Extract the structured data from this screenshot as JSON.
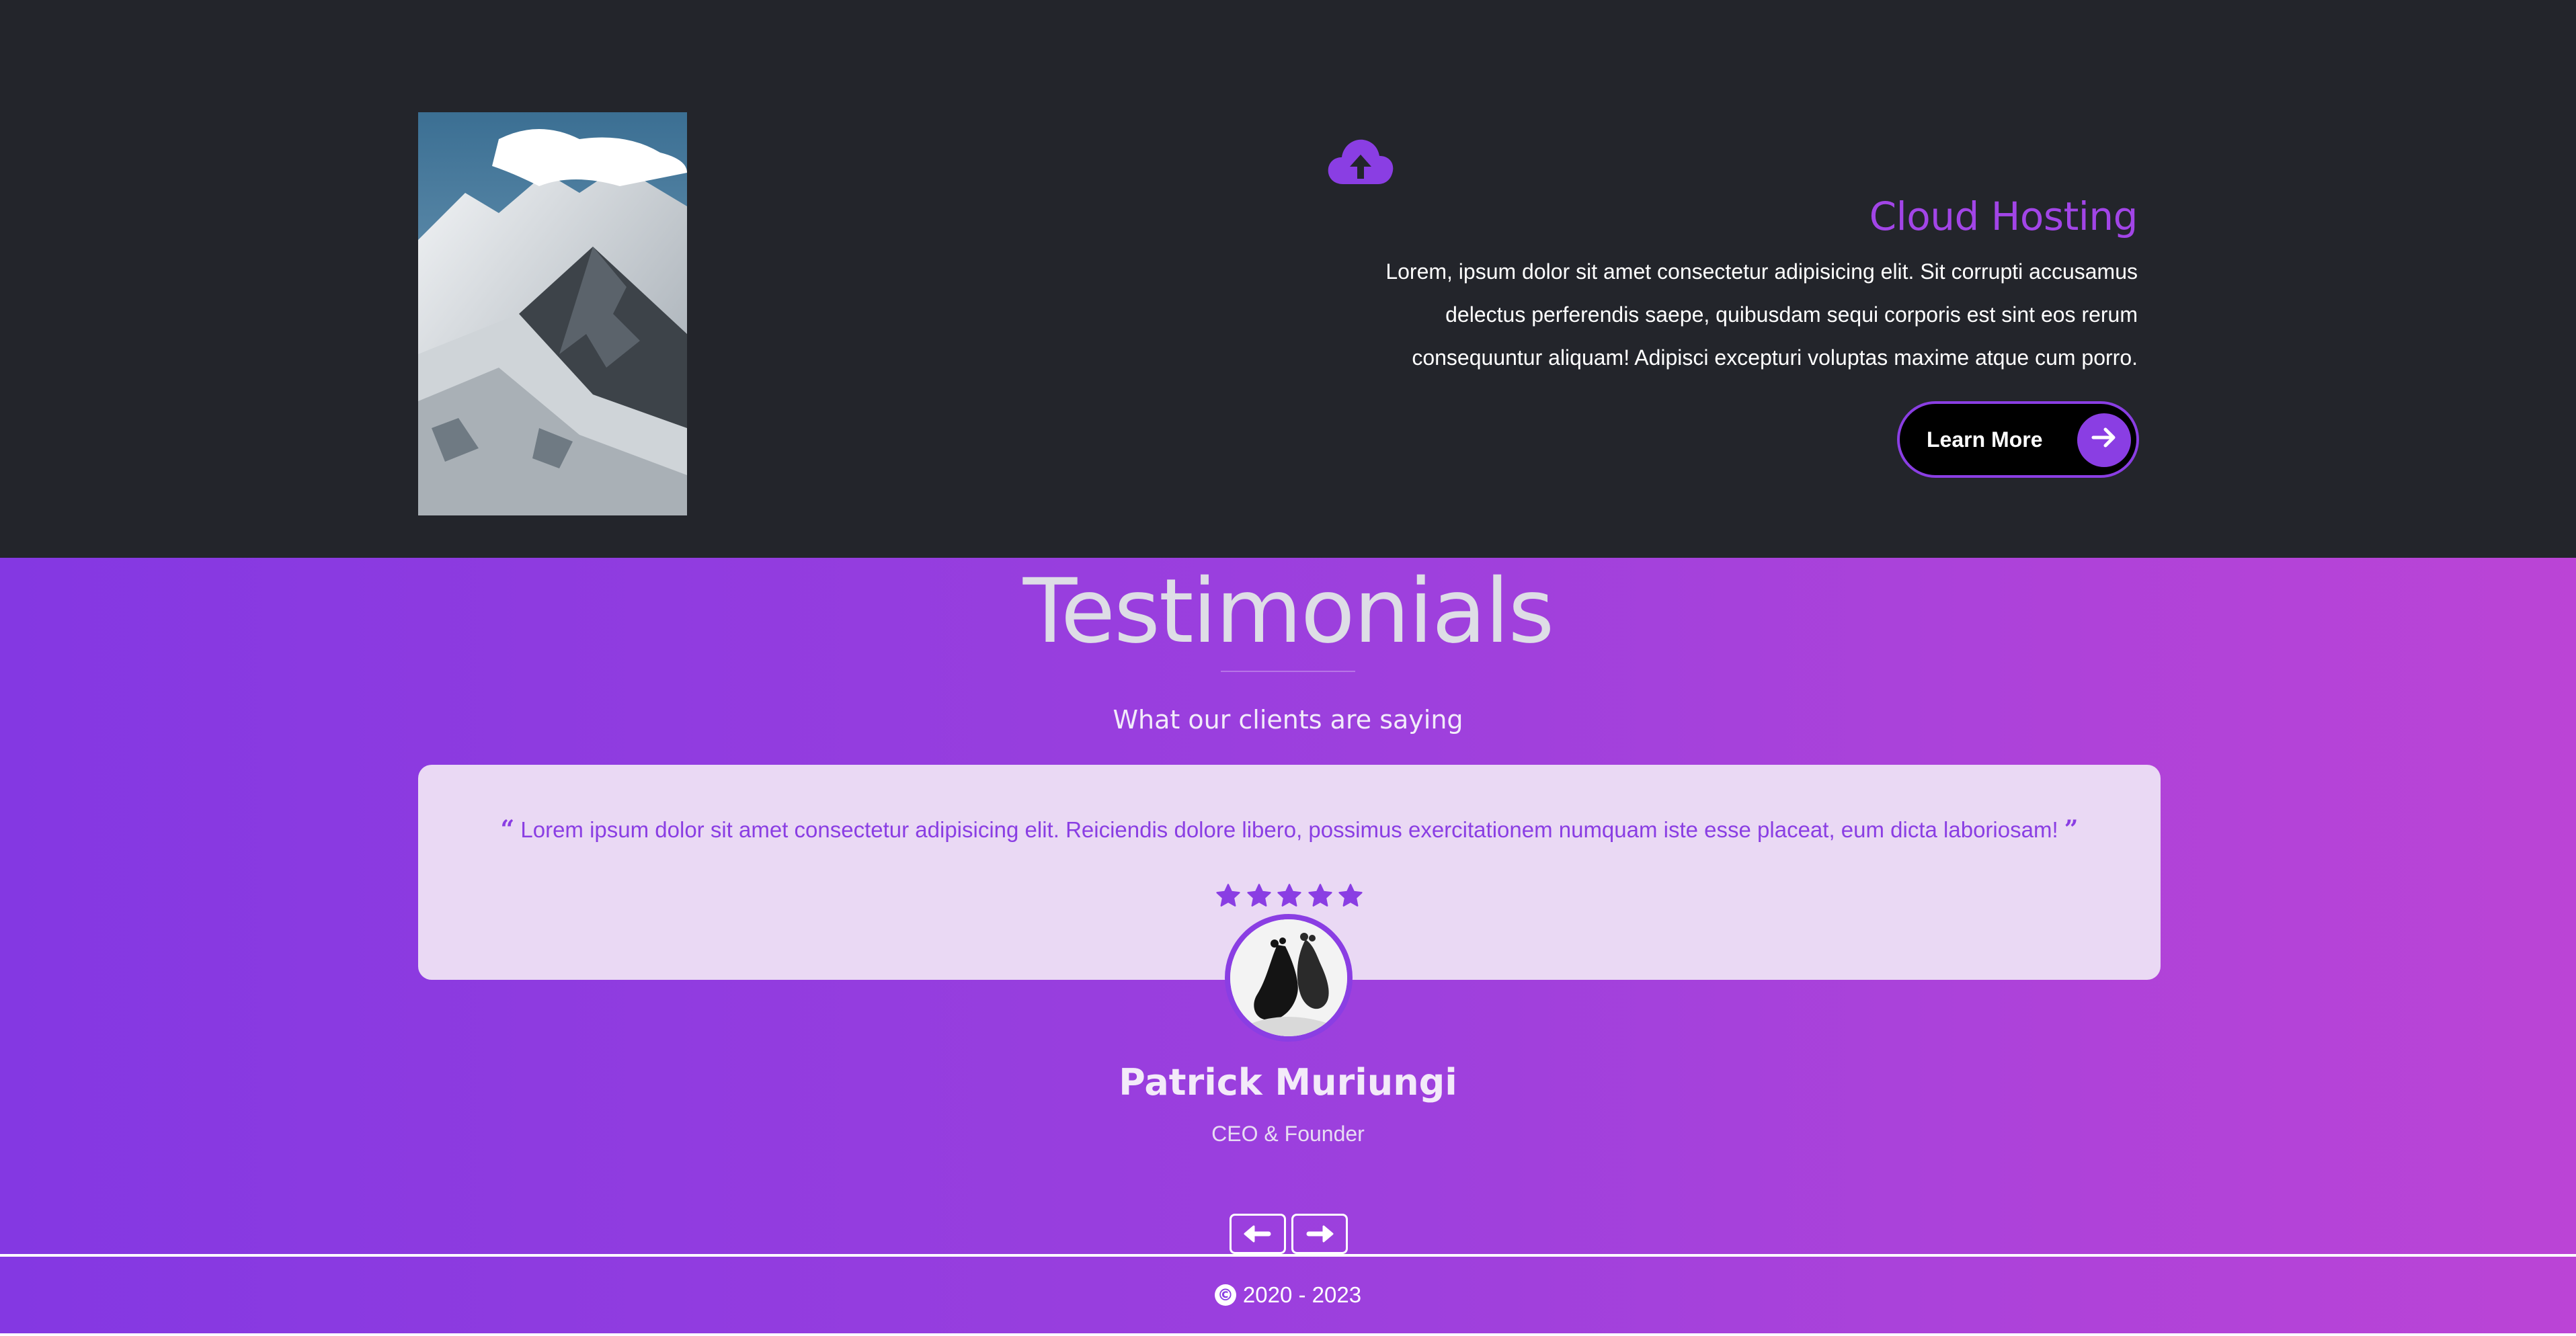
{
  "feature": {
    "image": "mountain-landscape",
    "icon": "cloud-upload-icon",
    "title": "Cloud Hosting",
    "paragraph_lines": [
      "Lorem, ipsum dolor sit amet consectetur adipisicing elit. Sit corrupti accusamus",
      "delectus perferendis saepe, quibusdam sequi corporis est sint eos rerum",
      "consequuntur aliquam! Adipisci excepturi voluptas maxime atque cum porro."
    ],
    "button_label": "Learn More",
    "button_icon": "arrow-right-icon"
  },
  "testimonials": {
    "title": "Testimonials",
    "subtitle": "What our clients are saying",
    "quote": "Lorem ipsum dolor sit amet consectetur adipisicing elit. Reiciendis dolore libero, possimus exercitationem numquam iste esse placeat, eum dicta laboriosam!",
    "rating": 5,
    "rating_max": 5,
    "name": "Patrick Muriungi",
    "role": "CEO & Founder",
    "prev_icon": "arrow-left-icon",
    "next_icon": "arrow-right-icon"
  },
  "footer": {
    "copyright_symbol": "©",
    "text": "2020 - 2023"
  },
  "colors": {
    "dark_bg": "#23252b",
    "accent": "#8a3ee3",
    "title_purple": "#a245e7",
    "gradient_start": "#8438e2",
    "gradient_end": "#bb44d6",
    "card_bg": "#ead9f4"
  }
}
